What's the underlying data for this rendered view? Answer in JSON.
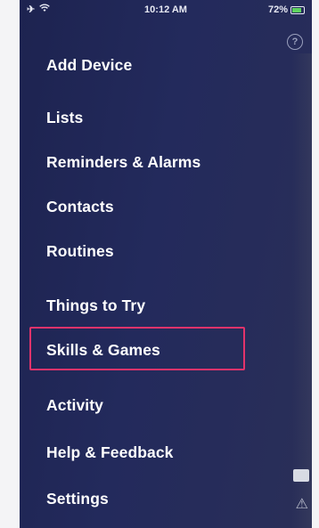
{
  "status_bar": {
    "time": "10:12 AM",
    "battery": "72%",
    "battery_level": 0.72
  },
  "icons": {
    "help": "help-circle-icon",
    "airplane": "airplane-icon",
    "wifi": "wifi-icon",
    "battery": "battery-icon"
  },
  "menu": {
    "items": [
      {
        "label": "Add Device"
      },
      {
        "label": "Lists"
      },
      {
        "label": "Reminders & Alarms"
      },
      {
        "label": "Contacts"
      },
      {
        "label": "Routines"
      },
      {
        "label": "Things to Try"
      },
      {
        "label": "Skills & Games"
      },
      {
        "label": "Activity"
      },
      {
        "label": "Help & Feedback"
      },
      {
        "label": "Settings"
      }
    ],
    "highlighted_item": "Skills & Games"
  },
  "colors": {
    "background": "#232a5c",
    "highlight": "#e2336b",
    "text": "#ffffff"
  }
}
